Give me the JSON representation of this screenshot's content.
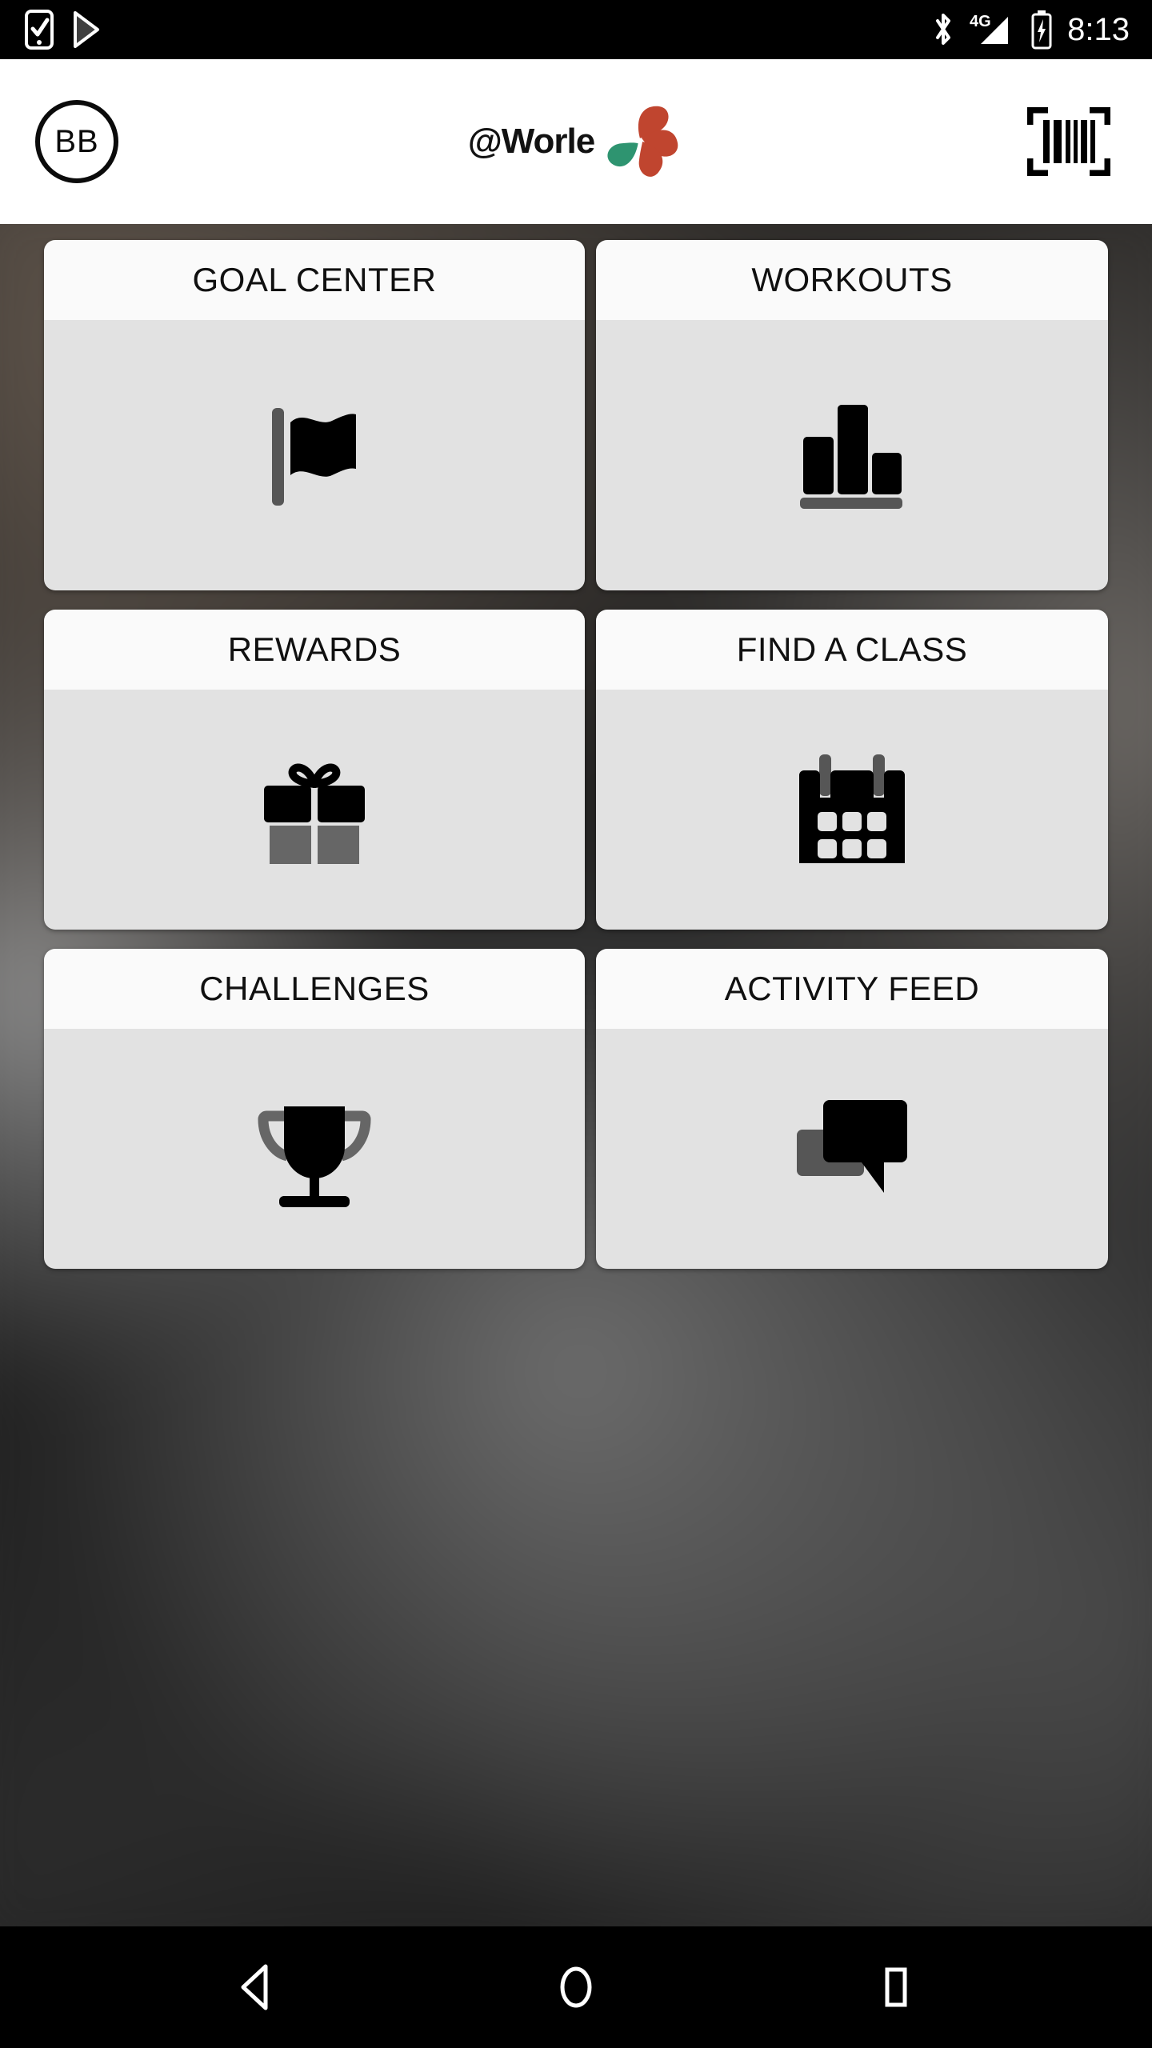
{
  "status_bar": {
    "time": "8:13",
    "left_icons": [
      "tasks-checkbox-icon",
      "play-store-icon"
    ],
    "right_icons": [
      "bluetooth-icon",
      "signal-4g-icon",
      "battery-charging-icon"
    ],
    "network_label": "4G",
    "background_color": "#000000",
    "foreground_color": "#ffffff"
  },
  "header": {
    "avatar_initials": "BB",
    "logo_text": "@Worle",
    "logo_colors": {
      "mark_primary": "#c0452f",
      "mark_accent": "#2e9470",
      "text": "#121212"
    },
    "scan_icon": "barcode-scan-icon",
    "background_color": "#ffffff"
  },
  "tiles": [
    {
      "id": "goal-center",
      "label": "GOAL CENTER",
      "icon": "flag-icon"
    },
    {
      "id": "workouts",
      "label": "WORKOUTS",
      "icon": "bar-chart-icon"
    },
    {
      "id": "rewards",
      "label": "REWARDS",
      "icon": "gift-icon"
    },
    {
      "id": "find-a-class",
      "label": "FIND A CLASS",
      "icon": "calendar-icon"
    },
    {
      "id": "challenges",
      "label": "CHALLENGES",
      "icon": "trophy-icon"
    },
    {
      "id": "activity-feed",
      "label": "ACTIVITY FEED",
      "icon": "chat-bubbles-icon"
    }
  ],
  "theme": {
    "tile_header_bg": "#fafafa",
    "tile_body_bg": "#e2e2e2",
    "icon_dark": "#000000",
    "icon_gray": "#565656",
    "page_bg": "#2a2a2a"
  },
  "nav_bar": {
    "back": "back-triangle-icon",
    "home": "home-circle-icon",
    "recents": "recents-square-icon",
    "background_color": "#000000"
  }
}
